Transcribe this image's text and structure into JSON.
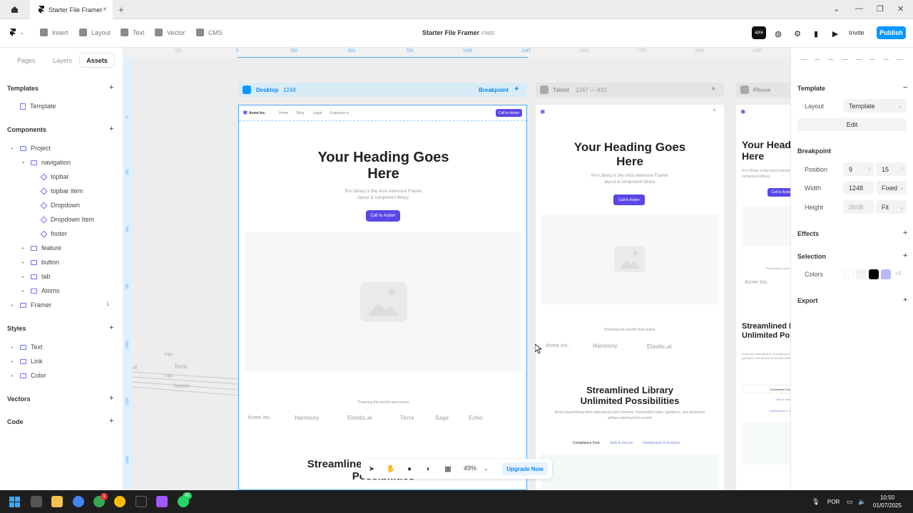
{
  "window": {
    "tab_title": "Starter File Framer",
    "tab_close": "×",
    "new_tab": "+",
    "controls": [
      "⌄",
      "—",
      "❐",
      "✕"
    ]
  },
  "toolbar": {
    "insert": "Insert",
    "layout": "Layout",
    "text": "Text",
    "vector": "Vector",
    "cms": "CMS",
    "doc_title": "Starter File Framer",
    "doc_badge": "FREE",
    "apta": "apta",
    "invite": "Invite",
    "publish": "Publish"
  },
  "left_panel": {
    "tabs": [
      "Pages",
      "Layers",
      "Assets"
    ],
    "templates_title": "Templates",
    "template_item": "Template",
    "components_title": "Components",
    "tree": [
      {
        "label": "Project",
        "kind": "folder"
      },
      {
        "label": "navigation",
        "kind": "folder"
      },
      {
        "label": "topbar",
        "kind": "component"
      },
      {
        "label": "topbar item",
        "kind": "component"
      },
      {
        "label": "Dropdown",
        "kind": "component"
      },
      {
        "label": "Dropdown Item",
        "kind": "component"
      },
      {
        "label": "footer",
        "kind": "component"
      },
      {
        "label": "feature",
        "kind": "folder"
      },
      {
        "label": "button",
        "kind": "folder"
      },
      {
        "label": "tab",
        "kind": "folder"
      },
      {
        "label": "Atoms",
        "kind": "folder"
      },
      {
        "label": "Framer",
        "kind": "folder"
      }
    ],
    "framer_count": "1",
    "styles_title": "Styles",
    "styles": [
      "Text",
      "Link",
      "Color"
    ],
    "vectors_title": "Vectors",
    "code_title": "Code",
    "plus": "+"
  },
  "canvas": {
    "ruler_top": [
      "-250",
      "0",
      "250",
      "500",
      "750",
      "1000",
      "1247",
      "1500",
      "1750",
      "2000",
      "2250"
    ],
    "ruler_left": [
      "0",
      "250",
      "500",
      "750",
      "1000",
      "1250",
      "1500"
    ],
    "desktop_label": "Desktop",
    "desktop_width": "1248",
    "breakpoint_label": "Breakpoint",
    "tablet_label": "Tablet",
    "tablet_range": "1247 — 810",
    "phone_label": "Phone",
    "offcanvas_logos": [
      "logo",
      "Terra",
      "logo",
      "haven"
    ],
    "offcanvas_ai": "ai",
    "site": {
      "brand": "Acme Inc.",
      "nav": [
        "Home",
        "Blog",
        "Legal",
        "Dropdown ▾"
      ],
      "cta_small": "Call to Action",
      "heading": "Your Heading Goes Here",
      "sub": "Pro Library is the most extensive Framer layout & component library",
      "cta": "Call to Action",
      "powering": "Powering the world's best teams",
      "logos": [
        "Acme Inc.",
        "Harmony",
        "Elastic.ai",
        "Terra",
        "Sage",
        "Echo"
      ],
      "heading2": "Streamlined Library Unlimited Possibilities",
      "sub2": "Avoid squandering time redesigning each element. Personalize hues, typefaces, and structures without starting from scratch",
      "tabs": [
        "Compliance First",
        "Safe & Secure",
        "Dashboards & Analytics"
      ]
    }
  },
  "floatbar": {
    "zoom": "49%",
    "upgrade": "Upgrade Now"
  },
  "right_panel": {
    "template_title": "Template",
    "layout_label": "Layout",
    "layout_value": "Template",
    "edit": "Edit",
    "breakpoint_title": "Breakpoint",
    "position_label": "Position",
    "position_x": "9",
    "position_y": "15",
    "width_label": "Width",
    "width_value": "1248",
    "width_mode": "Fixed",
    "height_label": "Height",
    "height_value": "3508",
    "height_mode": "Fit",
    "effects_title": "Effects",
    "selection_title": "Selection",
    "colors_label": "Colors",
    "colors_more": "+2",
    "colors": [
      "#ffffff",
      "#f4f4f4",
      "#000000",
      "#b6b8f8"
    ],
    "export_title": "Export",
    "accent": "#0a99ff"
  },
  "taskbar": {
    "lang": "POR",
    "time": "10:50",
    "date": "01/07/2025",
    "chrome_badge": "1",
    "whatsapp_badge": "45"
  }
}
